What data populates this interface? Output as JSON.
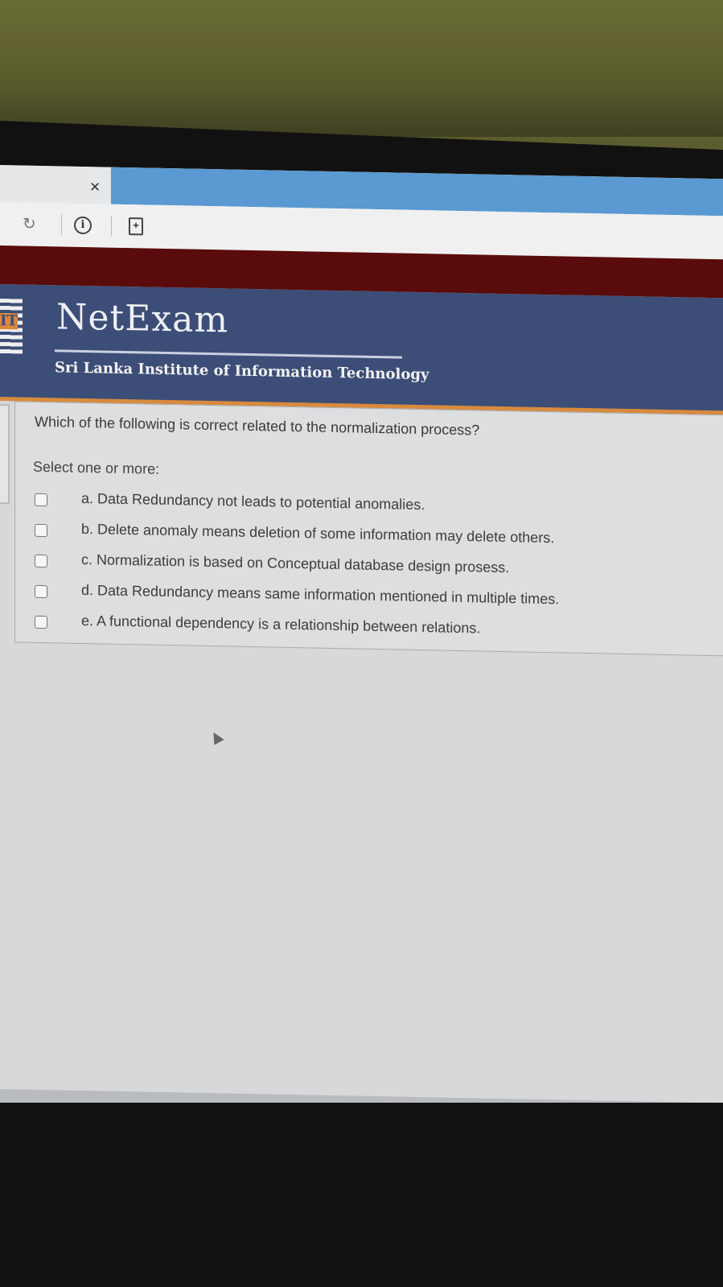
{
  "browser": {
    "close_glyph": "×",
    "info_glyph": "i",
    "page_glyph": "+",
    "reload_glyph": "↻"
  },
  "header": {
    "logo_letters": "IT",
    "brand": "NetExam",
    "institute": "Sri Lanka Institute of Information Technology"
  },
  "quiz": {
    "question": "Which of the following is correct related to the normalization process?",
    "instruction": "Select one or more:",
    "options": [
      {
        "label": "a. Data Redundancy not leads to potential anomalies.",
        "checked": false
      },
      {
        "label": "b. Delete anomaly means deletion of some information may delete others.",
        "checked": false
      },
      {
        "label": "c. Normalization  is based on Conceptual database design prosess.",
        "checked": false
      },
      {
        "label": "d. Data Redundancy means same information mentioned in multiple times.",
        "checked": false
      },
      {
        "label": "e. A functional dependency is a relationship between relations.",
        "checked": false
      }
    ]
  },
  "colors": {
    "header_bg": "#3c4e77",
    "header_accent": "#d98a3d",
    "top_bar": "#5a0b0b",
    "tab_active": "#5a99d1"
  }
}
